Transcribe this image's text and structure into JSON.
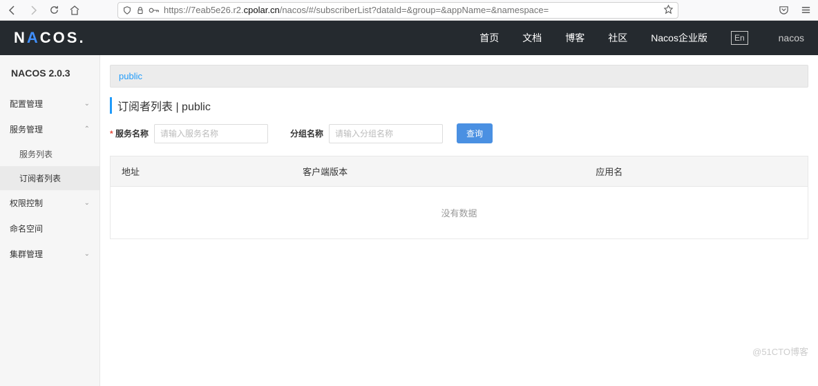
{
  "browser": {
    "url_prefix": "https://7eab5e26.r2.",
    "url_bold": "cpolar.cn",
    "url_suffix": "/nacos/#/subscriberList?dataId=&group=&appName=&namespace="
  },
  "header": {
    "nav": {
      "home": "首页",
      "docs": "文档",
      "blog": "博客",
      "community": "社区",
      "enterprise": "Nacos企业版",
      "lang": "En",
      "user": "nacos"
    }
  },
  "sidebar": {
    "title": "NACOS 2.0.3",
    "config_mgmt": "配置管理",
    "service_mgmt": "服务管理",
    "service_list": "服务列表",
    "subscriber_list": "订阅者列表",
    "auth_control": "权限控制",
    "namespace": "命名空间",
    "cluster_mgmt": "集群管理"
  },
  "main": {
    "namespace_link": "public",
    "page_title": "订阅者列表  |  public",
    "form": {
      "service_label": "服务名称",
      "service_placeholder": "请输入服务名称",
      "group_label": "分组名称",
      "group_placeholder": "请输入分组名称",
      "query_btn": "查询"
    },
    "table": {
      "col_address": "地址",
      "col_client_version": "客户端版本",
      "col_app_name": "应用名",
      "empty": "没有数据"
    }
  },
  "watermark": "@51CTO博客"
}
